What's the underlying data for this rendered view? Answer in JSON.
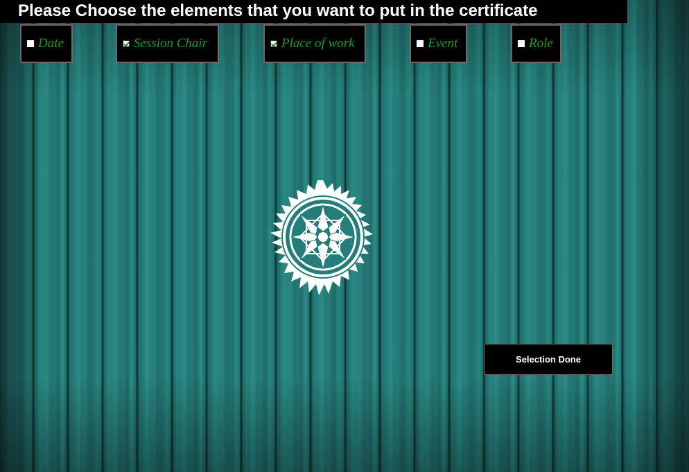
{
  "header": {
    "title": "Please Choose the elements that you want to put in the certificate"
  },
  "options": [
    {
      "label": "Date",
      "checked": false
    },
    {
      "label": "Session Chair",
      "checked": true
    },
    {
      "label": "Place of work",
      "checked": true
    },
    {
      "label": "Event",
      "checked": false
    },
    {
      "label": "Role",
      "checked": false
    }
  ],
  "actions": {
    "done_label": "Selection Done"
  },
  "colors": {
    "background": "#227672",
    "panel": "#000000",
    "option_text": "#1f9a1f",
    "title_text": "#ffffff"
  },
  "icons": {
    "emblem": "star-compass-emblem-icon"
  }
}
